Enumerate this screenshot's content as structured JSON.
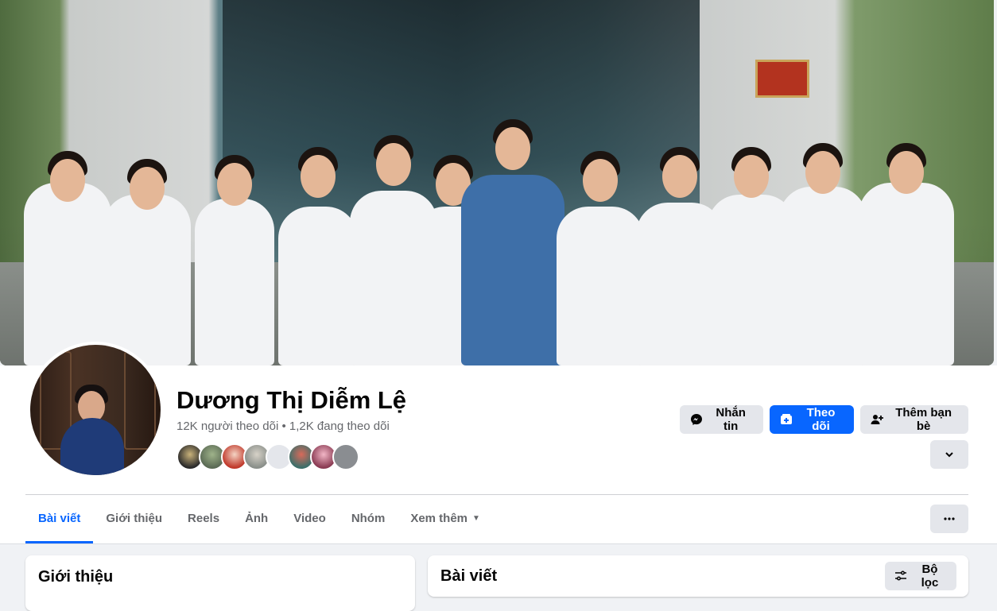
{
  "profile": {
    "name": "Dương Thị Diễm Lệ",
    "followers": "12K người theo dõi • 1,2K đang theo dõi"
  },
  "actions": {
    "message_label": "Nhắn tin",
    "follow_label": "Theo dõi",
    "add_friend_label": "Thêm bạn bè"
  },
  "tabs": [
    {
      "label": "Bài viết"
    },
    {
      "label": "Giới thiệu"
    },
    {
      "label": "Reels"
    },
    {
      "label": "Ảnh"
    },
    {
      "label": "Video"
    },
    {
      "label": "Nhóm"
    },
    {
      "label": "Xem thêm"
    }
  ],
  "intro_card": {
    "title": "Giới thiệu"
  },
  "posts_card": {
    "title": "Bài viết",
    "filter_label": "Bộ lọc"
  },
  "colors": {
    "accent": "#0866ff",
    "button_gray": "#e4e6eb",
    "text_secondary": "#65676b"
  },
  "icons": [
    "messenger-icon",
    "follow-icon",
    "add-friend-icon",
    "chevron-down-icon",
    "more-icon",
    "filter-icon"
  ]
}
